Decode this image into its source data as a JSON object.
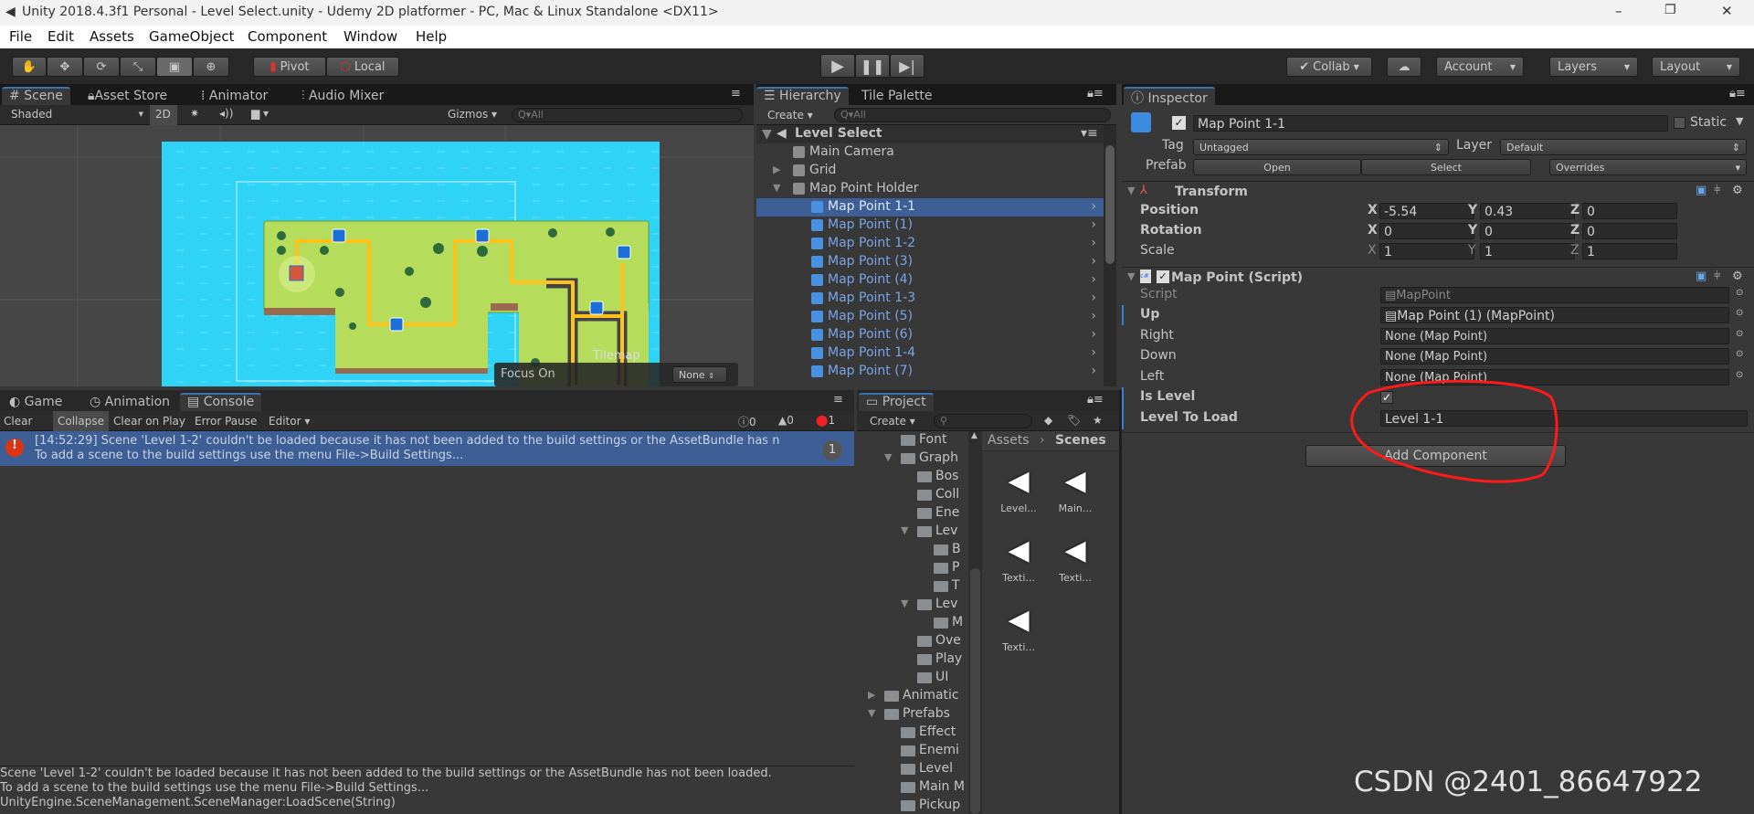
{
  "window": {
    "title": "Unity 2018.4.3f1 Personal - Level Select.unity - Udemy 2D platformer - PC, Mac & Linux Standalone <DX11>"
  },
  "menu": [
    "File",
    "Edit",
    "Assets",
    "GameObject",
    "Component",
    "Window",
    "Help"
  ],
  "toolbar": {
    "pivot": "Pivot",
    "local": "Local",
    "collab": "Collab",
    "account": "Account",
    "layers": "Layers",
    "layout": "Layout"
  },
  "scene_panel": {
    "tabs": [
      "Scene",
      "Asset Store",
      "Animator",
      "Audio Mixer"
    ],
    "shading": "Shaded",
    "mode_2d": "2D",
    "gizmos": "Gizmos",
    "search_placeholder": "All",
    "tilemap_overlay": {
      "title": "Tilemap",
      "focus_label": "Focus On",
      "focus_value": "None"
    }
  },
  "hierarchy": {
    "tabs": [
      "Hierarchy",
      "Tile Palette"
    ],
    "create": "Create",
    "search_placeholder": "All",
    "scene": "Level Select",
    "items": [
      {
        "label": "Main Camera",
        "depth": 1,
        "type": "object",
        "arrow": ""
      },
      {
        "label": "Grid",
        "depth": 1,
        "type": "object",
        "arrow": "collapsed"
      },
      {
        "label": "Map Point Holder",
        "depth": 1,
        "type": "object",
        "arrow": "expanded"
      },
      {
        "label": "Map Point 1-1",
        "depth": 2,
        "type": "prefab",
        "selected": true
      },
      {
        "label": "Map Point (1)",
        "depth": 2,
        "type": "prefab"
      },
      {
        "label": "Map Point 1-2",
        "depth": 2,
        "type": "prefab"
      },
      {
        "label": "Map Point (3)",
        "depth": 2,
        "type": "prefab"
      },
      {
        "label": "Map Point (4)",
        "depth": 2,
        "type": "prefab"
      },
      {
        "label": "Map Point 1-3",
        "depth": 2,
        "type": "prefab"
      },
      {
        "label": "Map Point (5)",
        "depth": 2,
        "type": "prefab"
      },
      {
        "label": "Map Point (6)",
        "depth": 2,
        "type": "prefab"
      },
      {
        "label": "Map Point 1-4",
        "depth": 2,
        "type": "prefab"
      },
      {
        "label": "Map Point  (7)",
        "depth": 2,
        "type": "prefab"
      }
    ]
  },
  "inspector": {
    "tab": "Inspector",
    "object_name": "Map Point 1-1",
    "active": true,
    "static_label": "Static",
    "tag_label": "Tag",
    "tag": "Untagged",
    "layer_label": "Layer",
    "layer": "Default",
    "prefab_label": "Prefab",
    "prefab_open": "Open",
    "prefab_select": "Select",
    "prefab_overrides": "Overrides",
    "transform": {
      "title": "Transform",
      "rows": [
        {
          "label": "Position",
          "x": "-5.54",
          "y": "0.43",
          "z": "0"
        },
        {
          "label": "Rotation",
          "x": "0",
          "y": "0",
          "z": "0"
        },
        {
          "label": "Scale",
          "x": "1",
          "y": "1",
          "z": "1"
        }
      ]
    },
    "axes": [
      "X",
      "Y",
      "Z"
    ],
    "script_component": {
      "title": "Map Point (Script)",
      "enabled": true,
      "script_label": "Script",
      "script_value": "MapPoint",
      "up_label": "Up",
      "up_value": "Map Point (1) (MapPoint)",
      "right_label": "Right",
      "right_value": "None (Map Point)",
      "down_label": "Down",
      "down_value": "None (Map Point)",
      "left_label": "Left",
      "left_value": "None (Map Point)",
      "is_level_label": "Is Level",
      "is_level": true,
      "level_to_load_label": "Level To Load",
      "level_to_load": "Level 1-1"
    },
    "add_component": "Add Component"
  },
  "console": {
    "tabs": [
      "Game",
      "Animation",
      "Console"
    ],
    "buttons": [
      "Clear",
      "Collapse",
      "Clear on Play",
      "Error Pause",
      "Editor"
    ],
    "counts": {
      "info": "0",
      "warning": "0",
      "error": "1"
    },
    "message_line1": "[14:52:29] Scene 'Level 1-2' couldn't be loaded because it has not been added to the build settings or the AssetBundle has n",
    "message_line2": "To add a scene to the build settings use the menu File->Build Settings...",
    "message_count": "1",
    "detail": [
      "Scene 'Level 1-2' couldn't be loaded because it has not been added to the build settings or the AssetBundle has not been loaded.",
      "To add a scene to the build settings use the menu File->Build Settings...",
      "UnityEngine.SceneManagement.SceneManager:LoadScene(String)"
    ]
  },
  "project": {
    "tab": "Project",
    "create": "Create",
    "tree": [
      {
        "label": "Font",
        "depth": 2,
        "arrow": ""
      },
      {
        "label": "Graph",
        "depth": 2,
        "arrow": "expanded"
      },
      {
        "label": "Bos",
        "depth": 3,
        "arrow": ""
      },
      {
        "label": "Coll",
        "depth": 3,
        "arrow": ""
      },
      {
        "label": "Ene",
        "depth": 3,
        "arrow": ""
      },
      {
        "label": "Lev",
        "depth": 3,
        "arrow": "expanded"
      },
      {
        "label": "B",
        "depth": 4,
        "arrow": ""
      },
      {
        "label": "P",
        "depth": 4,
        "arrow": ""
      },
      {
        "label": "T",
        "depth": 4,
        "arrow": ""
      },
      {
        "label": "Lev",
        "depth": 3,
        "arrow": "expanded"
      },
      {
        "label": "M",
        "depth": 4,
        "arrow": ""
      },
      {
        "label": "Ove",
        "depth": 3,
        "arrow": ""
      },
      {
        "label": "Play",
        "depth": 3,
        "arrow": ""
      },
      {
        "label": "UI",
        "depth": 3,
        "arrow": ""
      },
      {
        "label": "Animatic",
        "depth": 1,
        "arrow": "collapsed"
      },
      {
        "label": "Prefabs",
        "depth": 1,
        "arrow": "expanded"
      },
      {
        "label": "Effect",
        "depth": 2,
        "arrow": ""
      },
      {
        "label": "Enemi",
        "depth": 2,
        "arrow": ""
      },
      {
        "label": "Level",
        "depth": 2,
        "arrow": ""
      },
      {
        "label": "Main M",
        "depth": 2,
        "arrow": ""
      },
      {
        "label": "Pickup",
        "depth": 2,
        "arrow": ""
      }
    ],
    "breadcrumb": [
      "Assets",
      "Scenes"
    ],
    "assets": [
      "Level...",
      "Main...",
      "Texti...",
      "Texti...",
      "Texti..."
    ]
  },
  "watermark": "CSDN @2401_86647922",
  "colors": {
    "selection": "#3e5f96",
    "prefab_text": "#7ba4e6",
    "annotation": "#ff1a1a",
    "water": "#2fd3f5",
    "grass": "#b5dd5b",
    "path": "#ffc21a"
  }
}
